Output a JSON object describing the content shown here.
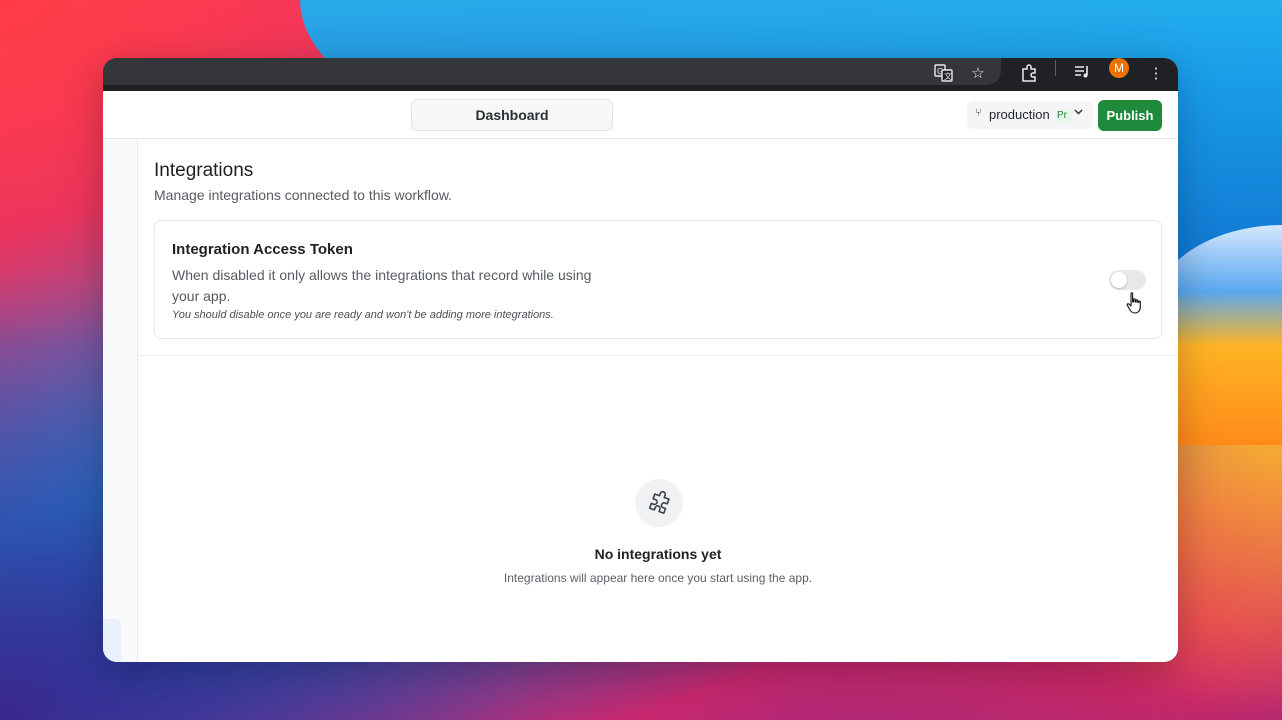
{
  "browser": {
    "profile_initial": "M",
    "icons": [
      "translate-icon",
      "star-icon",
      "extensions-icon",
      "media-icon",
      "menu-icon"
    ]
  },
  "topbar": {
    "dashboard_tab": "Dashboard",
    "branch": {
      "label": "production",
      "badge": "Pr"
    },
    "publish_label": "Publish"
  },
  "integrations": {
    "title": "Integrations",
    "subtitle": "Manage integrations connected to this workflow.",
    "access_token": {
      "title": "Integration Access Token",
      "description": "When disabled it only allows the integrations that record while using your app.",
      "note": "You should disable once you are ready and won't be adding more integrations.",
      "enabled": false
    }
  },
  "empty_state": {
    "title": "No integrations yet",
    "description": "Integrations will appear here once you start using the app."
  },
  "colors": {
    "publish": "#1f8a3b",
    "avatar": "#e8710a"
  }
}
